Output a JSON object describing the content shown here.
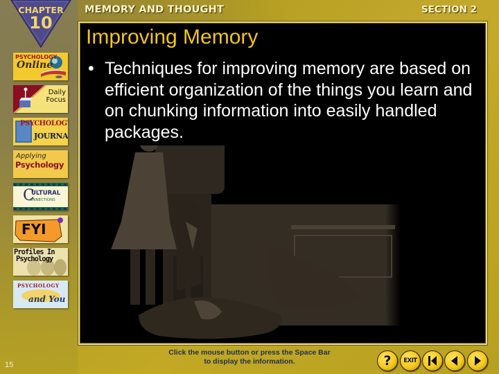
{
  "header": {
    "chapter_word": "CHAPTER",
    "chapter_number": "10",
    "chapter_title": "MEMORY AND THOUGHT",
    "section": "SECTION 2"
  },
  "sidebar": {
    "items": [
      {
        "id": "psychology-online",
        "label_top": "PSYCHOLOGY",
        "label_bottom": "Online"
      },
      {
        "id": "daily-focus",
        "label_top": "Daily",
        "label_bottom": "Focus"
      },
      {
        "id": "psychology-journal",
        "label_top": "PSYCHOLOGY",
        "label_bottom": "JOURNAL"
      },
      {
        "id": "applying-psychology",
        "label_top": "Applying",
        "label_bottom": "Psychology"
      },
      {
        "id": "cultural-connections",
        "label_top": "ULTURAL",
        "label_bottom": "ONNECTIONS",
        "initial": "C"
      },
      {
        "id": "fyi",
        "label_top": "FYI",
        "label_bottom": ""
      },
      {
        "id": "profiles-in-psychology",
        "label_top": "Profiles In",
        "label_bottom": "Psychology"
      },
      {
        "id": "psychology-and-you",
        "label_top": "PSYCHOLOGY",
        "label_bottom": "and You"
      }
    ]
  },
  "slide": {
    "title": "Improving Memory",
    "bullets": [
      "Techniques for improving memory are based on efficient organization of the things you learn and on chunking information into easily handled packages."
    ],
    "bullet_symbol": "•"
  },
  "footer": {
    "page_number": "15",
    "instruction_line1": "Click the mouse button or press the Space Bar",
    "instruction_line2": "to display the information.",
    "nav": [
      {
        "id": "help",
        "icon": "question-icon",
        "label": "?"
      },
      {
        "id": "exit",
        "icon": "exit-icon",
        "label": "EXIT"
      },
      {
        "id": "first",
        "icon": "skip-to-start-icon",
        "label": ""
      },
      {
        "id": "previous",
        "icon": "previous-icon",
        "label": ""
      },
      {
        "id": "next",
        "icon": "next-icon",
        "label": ""
      }
    ]
  },
  "colors": {
    "title_yellow": "#f2c51c",
    "body_text": "#ffffff",
    "frame_background": "#000000",
    "frame_border": "#e9d884",
    "chapter_badge": "#4f4a8c",
    "instruction_text": "#1d2f52",
    "nav_button": "#f4c81a"
  }
}
